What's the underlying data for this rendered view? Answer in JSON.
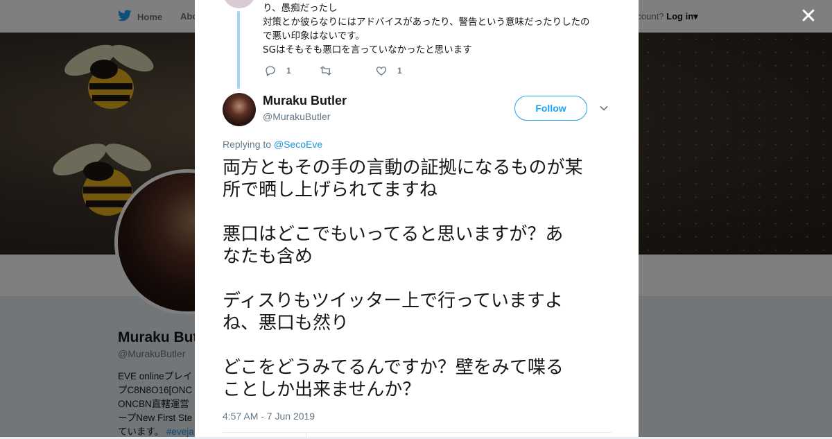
{
  "nav": {
    "home_label": "Home",
    "about_label": "Abo",
    "account_prompt": "ccount?",
    "login_label": "Log in"
  },
  "background_profile": {
    "name": "Muraku Butl",
    "handle": "@MurakuButler",
    "bio_lines": [
      "EVE onlineプレイ",
      "プC8N8O16[ONC",
      "ONCBN直轄運営",
      "ープNew First Ste",
      "ています。"
    ],
    "bio_hashtag": "#eveja"
  },
  "previous_tweet": {
    "lines": [
      "り、愚痴だったし",
      "対策とか彼らなりにはアドバイスがあったり、警告という意味だったりしたの",
      "で悪い印象はないです。",
      "SGはそもそも悪口を言っていなかったと思います"
    ],
    "reply_count": "1",
    "retweet_count": "",
    "like_count": "1"
  },
  "tweet": {
    "author_name": "Muraku Butler",
    "author_handle": "@MurakuButler",
    "follow_label": "Follow",
    "replying_prefix": "Replying to",
    "replying_to": "@SecoEve",
    "paragraphs": [
      [
        "両方ともその手の言動の証拠になるものが某",
        "所で晒し上げられてますね"
      ],
      [
        "悪口はどこでもいってると思いますが？あ",
        "なたも含め"
      ],
      [
        "ディスりもツイッター上で行っていますよ",
        "ね、悪口も然り"
      ],
      [
        "どこをどうみてるんですか？壁をみて喋る",
        "ことしか出来ませんか？"
      ]
    ],
    "timestamp": "4:57 AM - 7 Jun 2019"
  },
  "colors": {
    "accent": "#1da1f2",
    "thread_line": "#a7d3f1",
    "text_primary": "#14171a",
    "text_secondary": "#657786",
    "overlay": "rgba(0,0,0,0.5)"
  },
  "icons": {
    "brand": "twitter-bird-icon",
    "close": "close-icon",
    "reply": "reply-icon",
    "retweet": "retweet-icon",
    "like": "heart-icon",
    "more": "chevron-down-icon"
  }
}
